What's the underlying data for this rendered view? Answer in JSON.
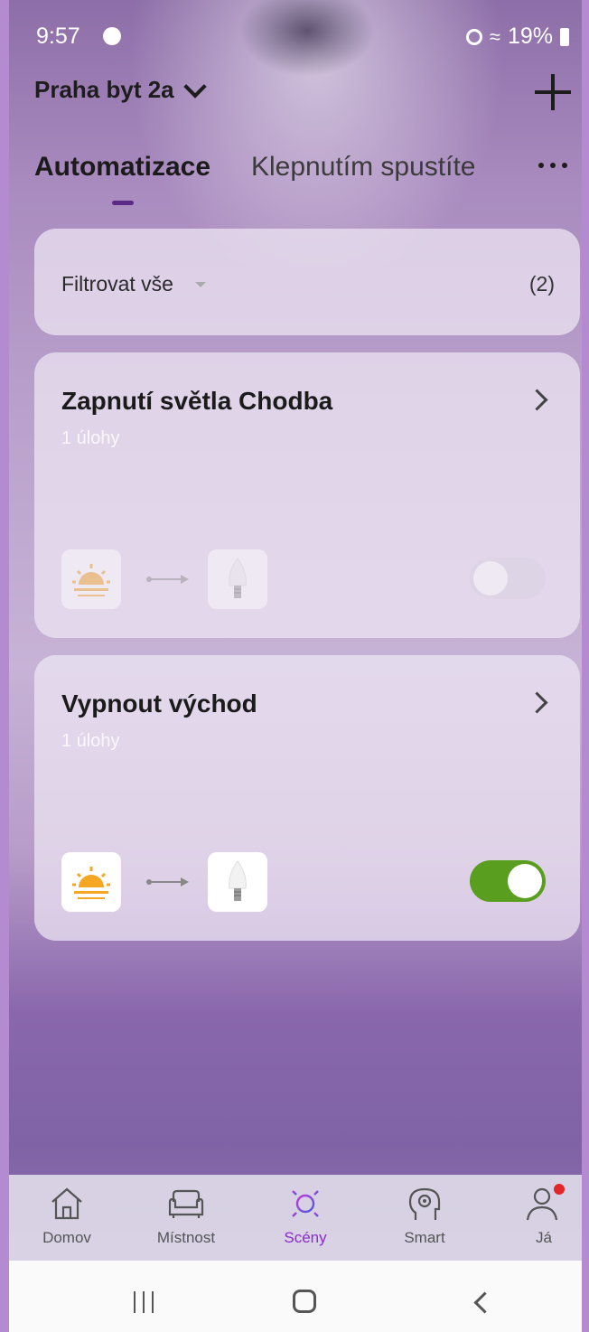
{
  "status_bar": {
    "time": "9:57",
    "battery": "19%"
  },
  "header": {
    "home_name": "Praha byt 2a"
  },
  "tabs": [
    {
      "label": "Automatizace",
      "active": true
    },
    {
      "label": "Klepnutím spustíte",
      "active": false
    }
  ],
  "filter": {
    "label": "Filtrovat vše",
    "count": "(2)"
  },
  "automations": [
    {
      "title": "Zapnutí světla Chodba",
      "subtitle": "1 úlohy",
      "enabled": false,
      "condition_icon": "sunrise-icon",
      "action_icon": "bulb-icon"
    },
    {
      "title": "Vypnout východ",
      "subtitle": "1 úlohy",
      "enabled": true,
      "condition_icon": "sunrise-icon",
      "action_icon": "bulb-icon"
    }
  ],
  "bottom_nav": [
    {
      "label": "Domov",
      "icon": "house-icon",
      "active": false
    },
    {
      "label": "Místnost",
      "icon": "sofa-icon",
      "active": false
    },
    {
      "label": "Scény",
      "icon": "sun-icon",
      "active": true
    },
    {
      "label": "Smart",
      "icon": "head-gear-icon",
      "active": false
    },
    {
      "label": "Já",
      "icon": "person-icon",
      "active": false,
      "badge": true
    }
  ],
  "colors": {
    "accent": "#8a2ad0",
    "toggle_on": "#5a9e1f",
    "toggle_off": "#d9d2e2",
    "tab_indicator": "#5b2a86",
    "sunrise": "#f5a623"
  }
}
